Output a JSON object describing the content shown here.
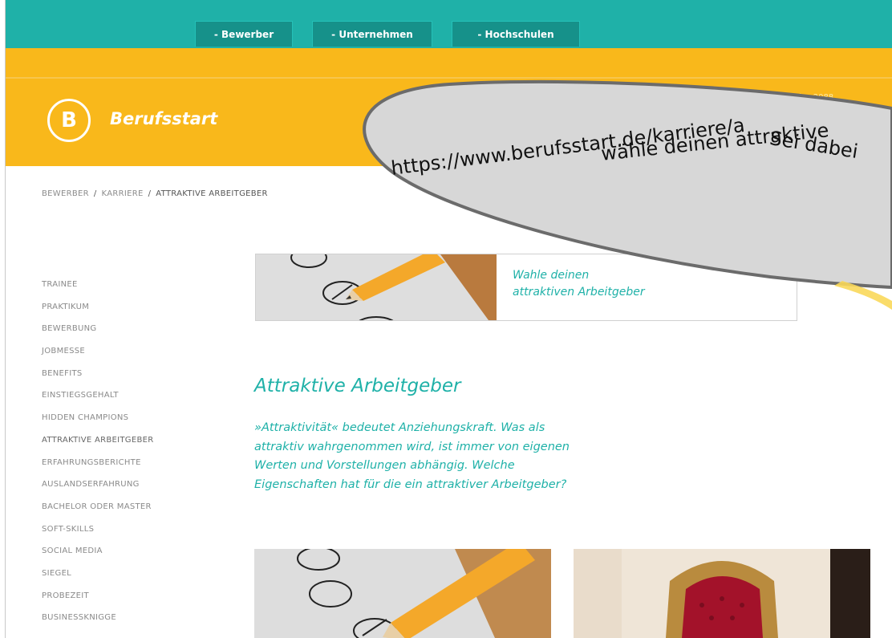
{
  "nav": {
    "tabs": [
      "- Bewerber",
      "- Unternehmen",
      "- Hochschulen"
    ]
  },
  "header": {
    "logo_letter": "B",
    "logo_text": "Berufsstart",
    "small_text": "W elus 2088"
  },
  "breadcrumb": {
    "items": [
      "BEWERBER",
      "KARRIERE",
      "ATTRAKTIVE ARBEITGEBER"
    ],
    "separator": "/"
  },
  "sidebar": {
    "items": [
      "TRAINEE",
      "PRAKTIKUM",
      "BEWERBUNG",
      "JOBMESSE",
      "BENEFITS",
      "EINSTIEGSGEHALT",
      "HIDDEN CHAMPIONS",
      "ATTRAKTIVE ARBEITGEBER",
      "ERFAHRUNGSBERICHTE",
      "AUSLANDSERFAHRUNG",
      "BACHELOR ODER MASTER",
      "SOFT-SKILLS",
      "SOCIAL MEDIA",
      "SIEGEL",
      "PROBEZEIT",
      "BUSINESSKNIGGE"
    ]
  },
  "banner": {
    "line1": "Wahle deinen",
    "line2": "attraktiven Arbeitgeber"
  },
  "main": {
    "title": "Attraktive Arbeitgeber",
    "intro_lines": [
      "»Attraktivität« bedeutet Anziehungskraft. Was als",
      "attraktiv wahrgenommen wird, ist immer von eigenen",
      "Werten und Vorstellungen abhängig. Welche",
      "Eigenschaften hat für die ein attraktiver Arbeitgeber?"
    ]
  },
  "overlay": {
    "line1": "Sei dabei",
    "line2": "wähle deinen attraktive",
    "line3": "https://www.berufsstart.de/karriere/a"
  },
  "colors": {
    "teal": "#1fb1a8",
    "orange": "#f9b81b",
    "bubble": "#d9d9d9"
  }
}
